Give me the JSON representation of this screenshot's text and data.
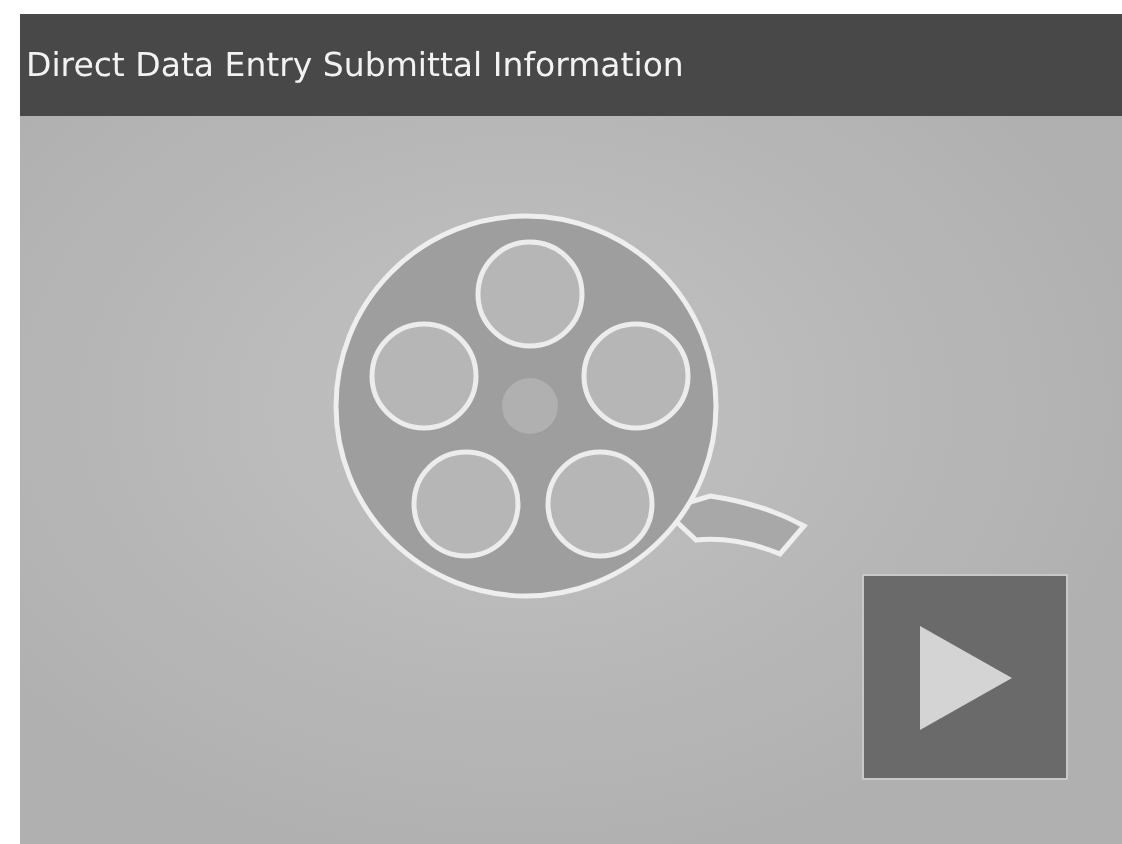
{
  "player": {
    "title": "Direct Data Entry Submittal Information"
  }
}
